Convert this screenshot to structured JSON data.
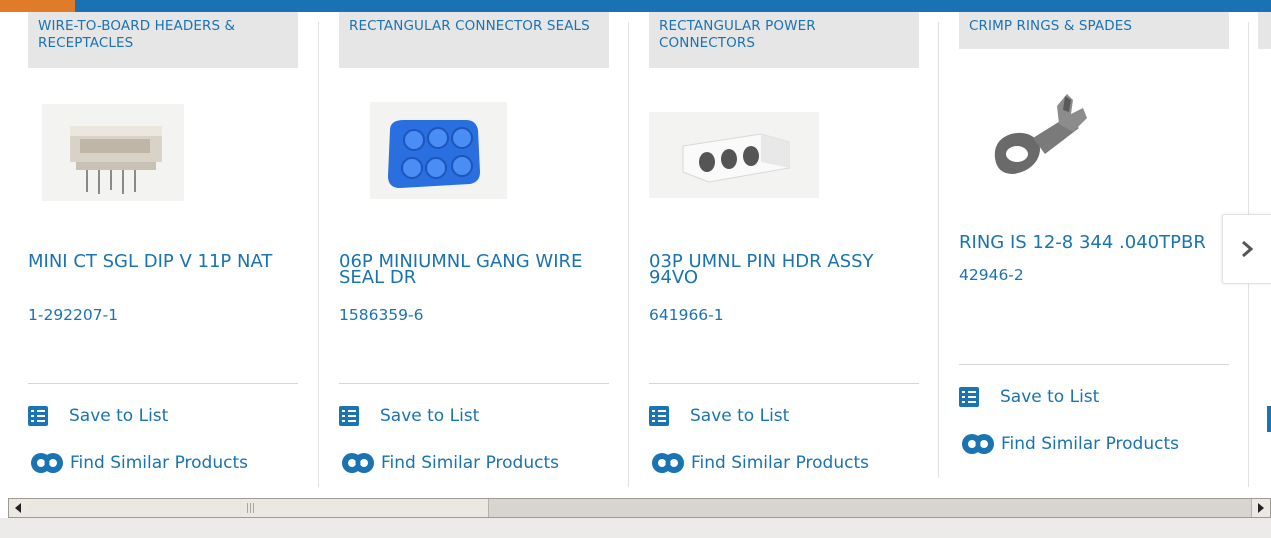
{
  "products": [
    {
      "category": "WIRE-TO-BOARD HEADERS & RECEPTACLES",
      "title": "MINI CT SGL DIP V 11P NAT",
      "part_number": "1-292207-1",
      "image": "pin-header-image"
    },
    {
      "category": "RECTANGULAR CONNECTOR SEALS",
      "title": "06P MINIUMNL GANG WIRE SEAL DR",
      "part_number": "1586359-6",
      "image": "wire-seal-image"
    },
    {
      "category": "RECTANGULAR POWER CONNECTORS",
      "title": "03P UMNL PIN HDR ASSY 94VO",
      "part_number": "641966-1",
      "image": "power-connector-image"
    },
    {
      "category": "CRIMP RINGS & SPADES",
      "title": "RING IS 12-8 344 .040TPBR",
      "part_number": "42946-2",
      "image": "ring-terminal-image"
    }
  ],
  "actions": {
    "save": "Save to List",
    "similar": "Find Similar Products"
  },
  "icons": {
    "save": "checklist-icon",
    "similar": "gears-icon",
    "next": "chevron-right-icon"
  },
  "colors": {
    "link": "#1a73b2",
    "top_bar": "#1a72b5",
    "top_bar_accent": "#e07b2a",
    "category_bg": "#e6e6e6"
  }
}
